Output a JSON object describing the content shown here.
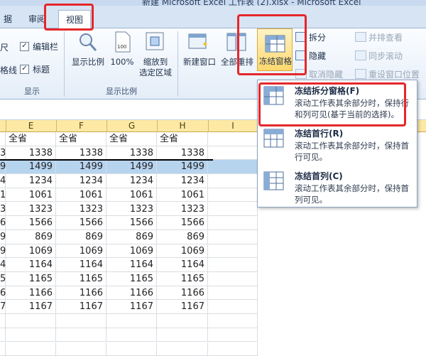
{
  "title_bar": {
    "title": "新建 Microsoft Excel 工作表 (2).xlsx - Microsoft Excel"
  },
  "tabs": [
    {
      "label": "据"
    },
    {
      "label": "审阅"
    },
    {
      "label": "视图",
      "active": true
    }
  ],
  "ribbon": {
    "show_group": {
      "label": "显示",
      "items": [
        {
          "label": "尺",
          "checked": false
        },
        {
          "label": "编辑栏",
          "checked": true
        },
        {
          "label": "格线",
          "checked": true
        },
        {
          "label": "标题",
          "checked": true
        }
      ]
    },
    "zoom_group": {
      "label": "显示比例",
      "zoom": "显示比例",
      "hundred": "100%",
      "zoom_selection": "缩放到\n选定区域"
    },
    "window_group": {
      "new_window": "新建窗口",
      "arrange_all": "全部重排",
      "freeze_panes": "冻结窗格",
      "split": "拆分",
      "hide": "隐藏",
      "unhide": "取消隐藏",
      "side_by_side": "并排查看",
      "sync_scroll": "同步滚动",
      "reset_position": "重设窗口位置"
    }
  },
  "sheet": {
    "columns": [
      "E",
      "F",
      "G",
      "H",
      "I"
    ],
    "header_row": [
      "全省",
      "全省",
      "全省",
      "全省"
    ],
    "left_partial": [
      "3",
      "9",
      "4",
      "1",
      "3",
      "6",
      "9",
      "9",
      "4",
      "5",
      "6",
      "7"
    ],
    "rows": [
      [
        1338,
        1338,
        1338,
        1338
      ],
      [
        1499,
        1499,
        1499,
        1499
      ],
      [
        1234,
        1234,
        1234,
        1234
      ],
      [
        1061,
        1061,
        1061,
        1061
      ],
      [
        1323,
        1323,
        1323,
        1323
      ],
      [
        1566,
        1566,
        1566,
        1566
      ],
      [
        869,
        869,
        869,
        869
      ],
      [
        1069,
        1069,
        1069,
        1069
      ],
      [
        1164,
        1164,
        1164,
        1164
      ],
      [
        1165,
        1165,
        1165,
        1165
      ],
      [
        1166,
        1166,
        1166,
        1166
      ],
      [
        1167,
        1167,
        1167,
        1167
      ]
    ],
    "selected_row_index": 1
  },
  "dropdown": {
    "items": [
      {
        "title": "冻结拆分窗格(F)",
        "desc": "滚动工作表其余部分时，保持行和列可见(基于当前的选择)。"
      },
      {
        "title": "冻结首行(R)",
        "desc": "滚动工作表其余部分时，保持首行可见。"
      },
      {
        "title": "冻结首列(C)",
        "desc": "滚动工作表其余部分时，保持首列可见。"
      }
    ]
  },
  "colors": {
    "highlight_red": "#e5272a",
    "selected_row": "#b7d4ef",
    "column_header": "#fde9a4"
  }
}
